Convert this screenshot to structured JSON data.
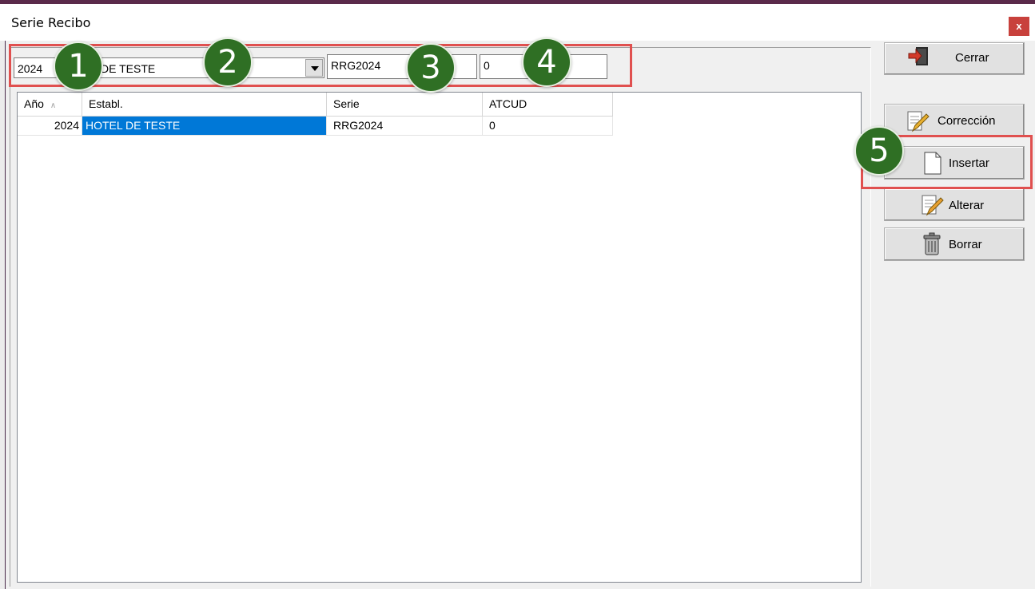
{
  "window": {
    "title": "Serie Recibo",
    "close_label": "x"
  },
  "form": {
    "year_value": "2024",
    "establishment_value": "HOTEL DE TESTE",
    "serie_value": "RRG2024",
    "atcud_value": "0"
  },
  "grid": {
    "columns": [
      "Año",
      "Establ.",
      "Serie",
      "ATCUD"
    ],
    "sort_indicator": "∧",
    "rows": [
      {
        "year": "2024",
        "establishment": "HOTEL DE TESTE",
        "serie": "RRG2024",
        "atcud": "0"
      }
    ]
  },
  "buttons": {
    "close": "Cerrar",
    "correction": "Corrección",
    "insert": "Insertar",
    "alter": "Alterar",
    "delete": "Borrar"
  },
  "icons": {
    "close": "exit-door-icon",
    "correction": "notepad-pencil-icon",
    "insert": "blank-page-icon",
    "alter": "notepad-pencil-icon",
    "delete": "trash-can-icon"
  },
  "annotations": [
    "1",
    "2",
    "3",
    "4",
    "5"
  ],
  "colors": {
    "callout": "#e0504f",
    "badge": "#2f6f24",
    "selection": "#0078d7",
    "close_button": "#c8413c"
  }
}
